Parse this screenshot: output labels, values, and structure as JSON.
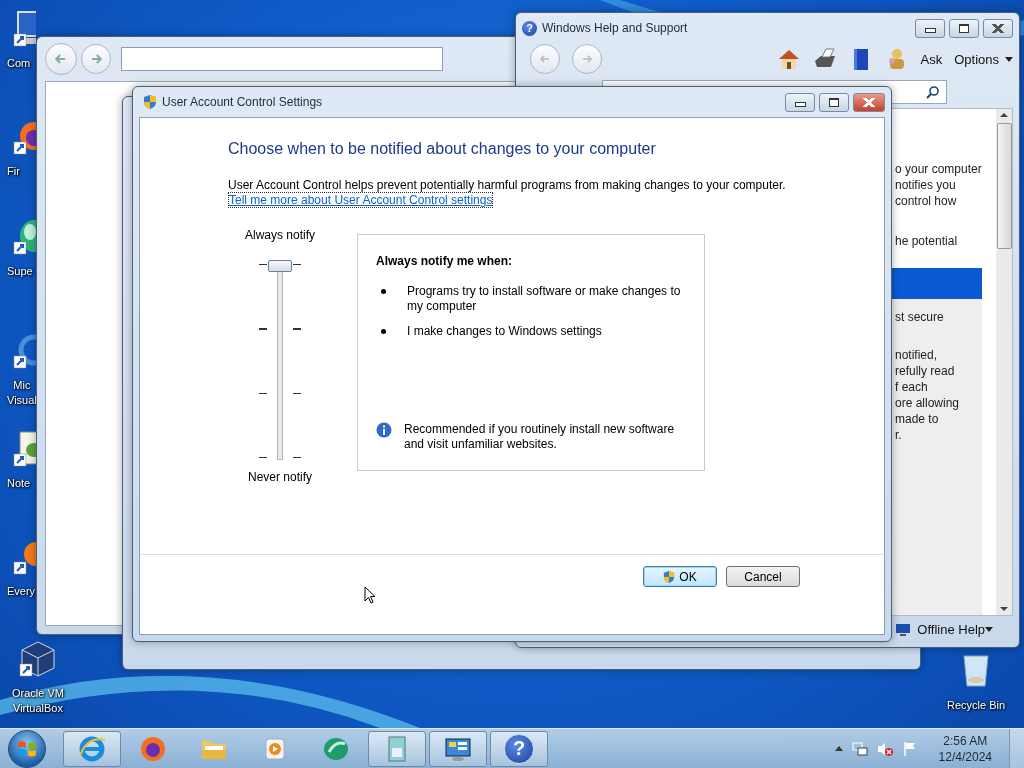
{
  "desktop": {
    "icons": [
      {
        "kind": "computer",
        "label": "Com"
      },
      {
        "kind": "fox",
        "label": "Fir"
      },
      {
        "kind": "leaf",
        "label": "Supe"
      },
      {
        "kind": "ring",
        "label": "Mic\nVisual"
      },
      {
        "kind": "notepad",
        "label": "Note"
      },
      {
        "kind": "orange",
        "label": "Every"
      },
      {
        "kind": "cube",
        "label": "Oracle VM\nVirtualBox"
      }
    ],
    "recycle_bin": {
      "label": "Recycle Bin"
    }
  },
  "help_window": {
    "title": "Windows Help and Support",
    "title_glyph": "?",
    "ask": "Ask",
    "options": "Options",
    "upper_lines": [
      "o your computer",
      "notifies you",
      "control how"
    ],
    "middle_line": "he potential",
    "panel_lines": [
      "st secure"
    ],
    "panel_paragraph": [
      "notified,",
      "refully read",
      "f each",
      "ore allowing",
      "made to",
      "r."
    ],
    "status": "Offline Help"
  },
  "uac": {
    "title": "User Account Control Settings",
    "heading": "Choose when to be notified about changes to your computer",
    "description": "User Account Control helps prevent potentially harmful programs from making changes to your computer.",
    "link": "Tell me more about User Account Control settings",
    "slider": {
      "top_label": "Always notify",
      "bottom_label": "Never notify",
      "level": 1
    },
    "info": {
      "heading": "Always notify me when:",
      "bullets": [
        [
          "Programs try to install software or make changes to",
          "my computer"
        ],
        [
          "I make changes to Windows settings"
        ]
      ],
      "note": [
        "Recommended if you routinely install new software",
        "and visit unfamiliar websites."
      ]
    },
    "buttons": [
      {
        "label": "OK",
        "kind": "shield",
        "default": true
      },
      {
        "label": "Cancel",
        "kind": "plain",
        "default": false
      }
    ]
  },
  "taskbar": {
    "items": [
      {
        "kind": "browser-e",
        "open": true
      },
      {
        "kind": "fox",
        "open": false
      },
      {
        "kind": "folder",
        "open": false
      },
      {
        "kind": "media",
        "open": false
      },
      {
        "kind": "leaf",
        "open": false
      },
      {
        "kind": "document",
        "open": true
      },
      {
        "kind": "panel",
        "open": true
      },
      {
        "kind": "help",
        "open": true,
        "glyph": "?"
      }
    ],
    "clock": {
      "time": "2:56 AM",
      "date": "12/4/2024"
    }
  }
}
